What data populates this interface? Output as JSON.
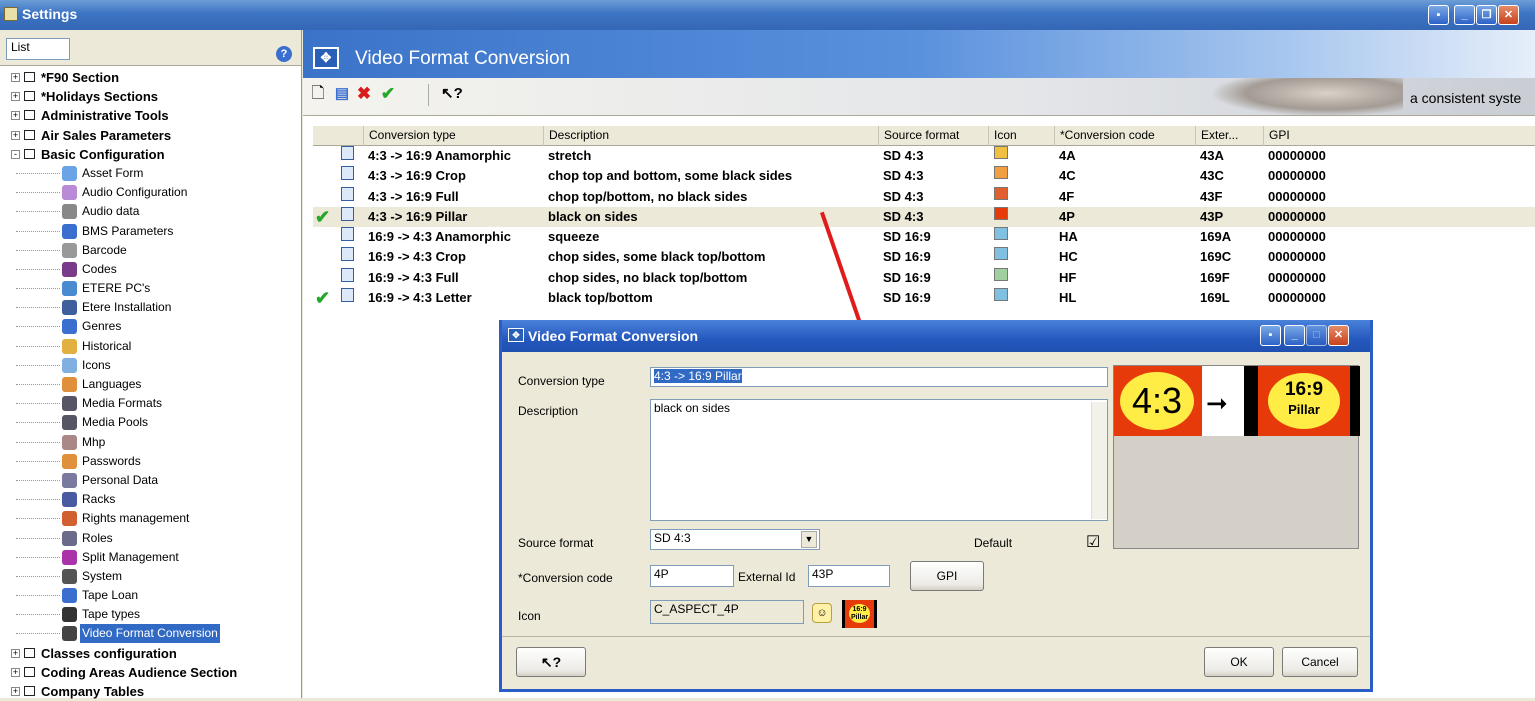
{
  "window": {
    "title": "Settings"
  },
  "left_panel": {
    "list_tab": "List",
    "tree": [
      {
        "label": "*F90 Section",
        "level": 0,
        "expander": "+"
      },
      {
        "label": "*Holidays Sections",
        "level": 0,
        "expander": "+"
      },
      {
        "label": "Administrative Tools",
        "level": 0,
        "expander": "+"
      },
      {
        "label": "Air Sales Parameters",
        "level": 0,
        "expander": "+"
      },
      {
        "label": "Basic Configuration",
        "level": 0,
        "expander": "-"
      },
      {
        "label": "Asset Form",
        "level": 1,
        "icon": "asset-form-icon"
      },
      {
        "label": "Audio Configuration",
        "level": 1,
        "icon": "audio-configuration-icon"
      },
      {
        "label": "Audio data",
        "level": 1,
        "icon": "audio-data-icon"
      },
      {
        "label": "BMS Parameters",
        "level": 1,
        "icon": "bms-parameters-icon"
      },
      {
        "label": "Barcode",
        "level": 1,
        "icon": "barcode-icon"
      },
      {
        "label": "Codes",
        "level": 1,
        "icon": "codes-icon"
      },
      {
        "label": "ETERE PC's",
        "level": 1,
        "icon": "etere-pcs-icon"
      },
      {
        "label": "Etere Installation",
        "level": 1,
        "icon": "etere-installation-icon"
      },
      {
        "label": "Genres",
        "level": 1,
        "icon": "genres-icon"
      },
      {
        "label": "Historical",
        "level": 1,
        "icon": "historical-icon"
      },
      {
        "label": "Icons",
        "level": 1,
        "icon": "icons-icon"
      },
      {
        "label": "Languages",
        "level": 1,
        "icon": "languages-icon"
      },
      {
        "label": "Media Formats",
        "level": 1,
        "icon": "media-formats-icon"
      },
      {
        "label": "Media Pools",
        "level": 1,
        "icon": "media-pools-icon"
      },
      {
        "label": "Mhp",
        "level": 1,
        "icon": "mhp-icon"
      },
      {
        "label": "Passwords",
        "level": 1,
        "icon": "passwords-icon"
      },
      {
        "label": "Personal Data",
        "level": 1,
        "icon": "personal-data-icon"
      },
      {
        "label": "Racks",
        "level": 1,
        "icon": "racks-icon"
      },
      {
        "label": "Rights management",
        "level": 1,
        "icon": "rights-management-icon"
      },
      {
        "label": "Roles",
        "level": 1,
        "icon": "roles-icon"
      },
      {
        "label": "Split Management",
        "level": 1,
        "icon": "split-management-icon"
      },
      {
        "label": "System",
        "level": 1,
        "icon": "system-icon"
      },
      {
        "label": "Tape Loan",
        "level": 1,
        "icon": "tape-loan-icon"
      },
      {
        "label": "Tape types",
        "level": 1,
        "icon": "tape-types-icon"
      },
      {
        "label": "Video Format Conversion",
        "level": 1,
        "icon": "video-format-conversion-icon",
        "selected": true
      },
      {
        "label": "Classes configuration",
        "level": 0,
        "expander": "+"
      },
      {
        "label": "Coding Areas Audience Section",
        "level": 0,
        "expander": "+"
      },
      {
        "label": "Company Tables",
        "level": 0,
        "expander": "+"
      }
    ]
  },
  "main": {
    "header_title": "Video Format Conversion",
    "tagline": "a consistent syste",
    "toolbar": [
      "new-icon",
      "save-icon",
      "delete-icon",
      "confirm-icon",
      "context-help-icon"
    ],
    "grid": {
      "columns": [
        "Conversion type",
        "Description",
        "Source format",
        "Icon",
        "*Conversion code",
        "Exter...",
        "GPI"
      ],
      "rows": [
        {
          "check": "",
          "type": "4:3 -> 16:9 Anamorphic",
          "desc": "stretch",
          "src": "SD 4:3",
          "icon": "aspect-4a-icon",
          "code": "4A",
          "ext": "43A",
          "gpi": "00000000"
        },
        {
          "check": "",
          "type": "4:3 -> 16:9 Crop",
          "desc": "chop top and bottom, some black sides",
          "src": "SD 4:3",
          "icon": "aspect-4c-icon",
          "code": "4C",
          "ext": "43C",
          "gpi": "00000000"
        },
        {
          "check": "",
          "type": "4:3 -> 16:9 Full",
          "desc": "chop top/bottom, no black sides",
          "src": "SD 4:3",
          "icon": "aspect-4f-icon",
          "code": "4F",
          "ext": "43F",
          "gpi": "00000000"
        },
        {
          "check": "✔",
          "type": "4:3 -> 16:9 Pillar",
          "desc": "black on sides",
          "src": "SD 4:3",
          "icon": "aspect-4p-icon",
          "code": "4P",
          "ext": "43P",
          "gpi": "00000000",
          "selected": true
        },
        {
          "check": "",
          "type": "16:9 -> 4:3 Anamorphic",
          "desc": "squeeze",
          "src": "SD 16:9",
          "icon": "aspect-ha-icon",
          "code": "HA",
          "ext": "169A",
          "gpi": "00000000"
        },
        {
          "check": "",
          "type": "16:9 -> 4:3 Crop",
          "desc": "chop sides, some black top/bottom",
          "src": "SD 16:9",
          "icon": "aspect-hc-icon",
          "code": "HC",
          "ext": "169C",
          "gpi": "00000000"
        },
        {
          "check": "",
          "type": "16:9 -> 4:3 Full",
          "desc": "chop sides, no black top/bottom",
          "src": "SD 16:9",
          "icon": "aspect-hf-icon",
          "code": "HF",
          "ext": "169F",
          "gpi": "00000000"
        },
        {
          "check": "✔",
          "type": "16:9 -> 4:3 Letter",
          "desc": "black top/bottom",
          "src": "SD 16:9",
          "icon": "aspect-hl-icon",
          "code": "HL",
          "ext": "169L",
          "gpi": "00000000"
        }
      ]
    }
  },
  "dialog": {
    "title": "Video Format Conversion",
    "conversion_type_label": "Conversion type",
    "conversion_type_value": "4:3 -> 16:9 Pillar",
    "description_label": "Description",
    "description_value": "black on sides",
    "source_format_label": "Source format",
    "source_format_value": "SD 4:3",
    "default_label": "Default",
    "default_checked": "☑",
    "conversion_code_label": "*Conversion code",
    "conversion_code_value": "4P",
    "external_id_label": "External Id",
    "external_id_value": "43P",
    "gpi_button": "GPI",
    "icon_label": "Icon",
    "icon_value": "C_ASPECT_4P",
    "ok_button": "OK",
    "cancel_button": "Cancel",
    "preview": {
      "left_text": "4:3",
      "right_text": "16:9",
      "right_sub": "Pillar"
    },
    "small_icon": {
      "text": "16:9",
      "sub": "Pillar"
    }
  },
  "colors": {
    "title_blue": "#3d74c4",
    "accent_red": "#e01b1b",
    "check_green": "#23a82a"
  }
}
